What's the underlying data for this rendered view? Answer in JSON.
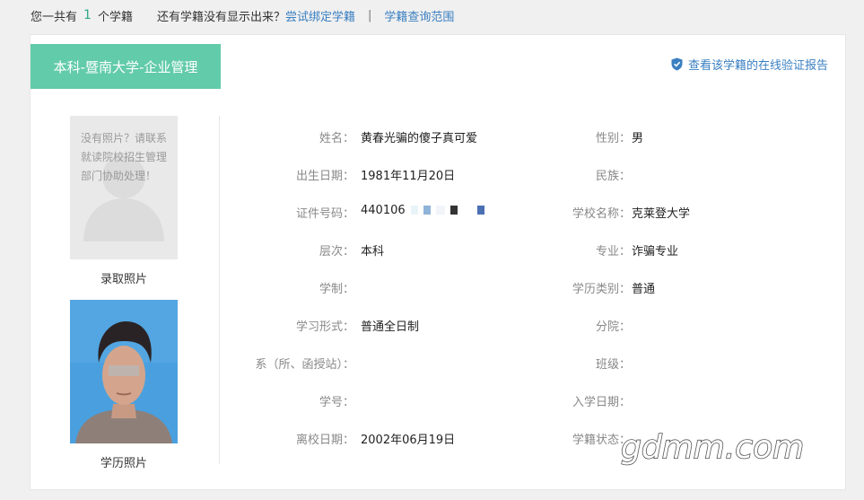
{
  "topbar": {
    "prefix": "您一共有",
    "count": "1",
    "suffix": "个学籍",
    "question": "还有学籍没有显示出来？",
    "bind_link": "尝试绑定学籍",
    "separator": "|",
    "scope_link": "学籍查询范围"
  },
  "card": {
    "tab_title": "本科-暨南大学-企业管理",
    "verify_link": "查看该学籍的在线验证报告",
    "no_photo_message": "没有照片？请联系就读院校招生管理部门协助处理！",
    "photo1_caption": "录取照片",
    "photo2_caption": "学历照片"
  },
  "fields": [
    {
      "left_label": "姓名：",
      "left_value": "黄春光骗的傻子真可爱",
      "right_label": "性别：",
      "right_value": "男"
    },
    {
      "left_label": "出生日期：",
      "left_value": "1981年11月20日",
      "right_label": "民族：",
      "right_value": ""
    },
    {
      "left_label": "证件号码：",
      "left_value": "440106",
      "right_label": "学校名称：",
      "right_value": "克莱登大学"
    },
    {
      "left_label": "层次：",
      "left_value": "本科",
      "right_label": "专业：",
      "right_value": "诈骗专业"
    },
    {
      "left_label": "学制：",
      "left_value": "",
      "right_label": "学历类别：",
      "right_value": "普通"
    },
    {
      "left_label": "学习形式：",
      "left_value": "普通全日制",
      "right_label": "分院：",
      "right_value": ""
    },
    {
      "left_label": "系（所、函授站）：",
      "left_value": "",
      "right_label": "班级：",
      "right_value": ""
    },
    {
      "left_label": "学号：",
      "left_value": "",
      "right_label": "入学日期：",
      "right_value": ""
    },
    {
      "left_label": "离校日期：",
      "left_value": "2002年06月19日",
      "right_label": "学籍状态：",
      "right_value": ""
    }
  ],
  "watermark": "gdmm.com",
  "colors": {
    "accent": "#62cba9",
    "link": "#3a7fc1",
    "count": "#2fa989"
  },
  "icons": {
    "verify": "shield-check-icon"
  }
}
